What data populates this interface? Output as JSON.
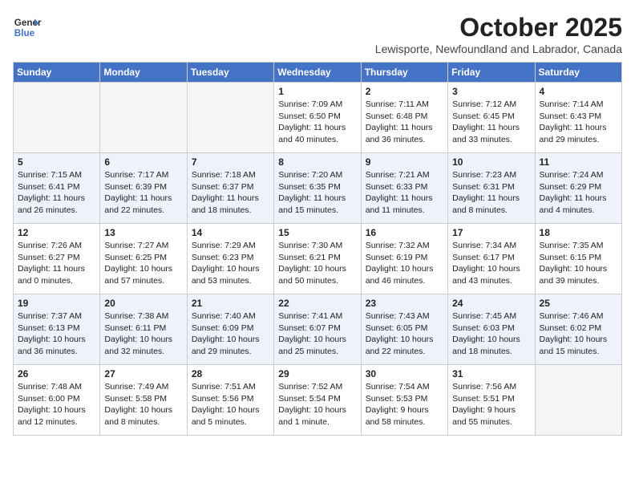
{
  "header": {
    "logo_line1": "General",
    "logo_line2": "Blue",
    "month": "October 2025",
    "subtitle": "Lewisporte, Newfoundland and Labrador, Canada"
  },
  "weekdays": [
    "Sunday",
    "Monday",
    "Tuesday",
    "Wednesday",
    "Thursday",
    "Friday",
    "Saturday"
  ],
  "weeks": [
    [
      {
        "day": "",
        "content": ""
      },
      {
        "day": "",
        "content": ""
      },
      {
        "day": "",
        "content": ""
      },
      {
        "day": "1",
        "content": "Sunrise: 7:09 AM\nSunset: 6:50 PM\nDaylight: 11 hours\nand 40 minutes."
      },
      {
        "day": "2",
        "content": "Sunrise: 7:11 AM\nSunset: 6:48 PM\nDaylight: 11 hours\nand 36 minutes."
      },
      {
        "day": "3",
        "content": "Sunrise: 7:12 AM\nSunset: 6:45 PM\nDaylight: 11 hours\nand 33 minutes."
      },
      {
        "day": "4",
        "content": "Sunrise: 7:14 AM\nSunset: 6:43 PM\nDaylight: 11 hours\nand 29 minutes."
      }
    ],
    [
      {
        "day": "5",
        "content": "Sunrise: 7:15 AM\nSunset: 6:41 PM\nDaylight: 11 hours\nand 26 minutes."
      },
      {
        "day": "6",
        "content": "Sunrise: 7:17 AM\nSunset: 6:39 PM\nDaylight: 11 hours\nand 22 minutes."
      },
      {
        "day": "7",
        "content": "Sunrise: 7:18 AM\nSunset: 6:37 PM\nDaylight: 11 hours\nand 18 minutes."
      },
      {
        "day": "8",
        "content": "Sunrise: 7:20 AM\nSunset: 6:35 PM\nDaylight: 11 hours\nand 15 minutes."
      },
      {
        "day": "9",
        "content": "Sunrise: 7:21 AM\nSunset: 6:33 PM\nDaylight: 11 hours\nand 11 minutes."
      },
      {
        "day": "10",
        "content": "Sunrise: 7:23 AM\nSunset: 6:31 PM\nDaylight: 11 hours\nand 8 minutes."
      },
      {
        "day": "11",
        "content": "Sunrise: 7:24 AM\nSunset: 6:29 PM\nDaylight: 11 hours\nand 4 minutes."
      }
    ],
    [
      {
        "day": "12",
        "content": "Sunrise: 7:26 AM\nSunset: 6:27 PM\nDaylight: 11 hours\nand 0 minutes."
      },
      {
        "day": "13",
        "content": "Sunrise: 7:27 AM\nSunset: 6:25 PM\nDaylight: 10 hours\nand 57 minutes."
      },
      {
        "day": "14",
        "content": "Sunrise: 7:29 AM\nSunset: 6:23 PM\nDaylight: 10 hours\nand 53 minutes."
      },
      {
        "day": "15",
        "content": "Sunrise: 7:30 AM\nSunset: 6:21 PM\nDaylight: 10 hours\nand 50 minutes."
      },
      {
        "day": "16",
        "content": "Sunrise: 7:32 AM\nSunset: 6:19 PM\nDaylight: 10 hours\nand 46 minutes."
      },
      {
        "day": "17",
        "content": "Sunrise: 7:34 AM\nSunset: 6:17 PM\nDaylight: 10 hours\nand 43 minutes."
      },
      {
        "day": "18",
        "content": "Sunrise: 7:35 AM\nSunset: 6:15 PM\nDaylight: 10 hours\nand 39 minutes."
      }
    ],
    [
      {
        "day": "19",
        "content": "Sunrise: 7:37 AM\nSunset: 6:13 PM\nDaylight: 10 hours\nand 36 minutes."
      },
      {
        "day": "20",
        "content": "Sunrise: 7:38 AM\nSunset: 6:11 PM\nDaylight: 10 hours\nand 32 minutes."
      },
      {
        "day": "21",
        "content": "Sunrise: 7:40 AM\nSunset: 6:09 PM\nDaylight: 10 hours\nand 29 minutes."
      },
      {
        "day": "22",
        "content": "Sunrise: 7:41 AM\nSunset: 6:07 PM\nDaylight: 10 hours\nand 25 minutes."
      },
      {
        "day": "23",
        "content": "Sunrise: 7:43 AM\nSunset: 6:05 PM\nDaylight: 10 hours\nand 22 minutes."
      },
      {
        "day": "24",
        "content": "Sunrise: 7:45 AM\nSunset: 6:03 PM\nDaylight: 10 hours\nand 18 minutes."
      },
      {
        "day": "25",
        "content": "Sunrise: 7:46 AM\nSunset: 6:02 PM\nDaylight: 10 hours\nand 15 minutes."
      }
    ],
    [
      {
        "day": "26",
        "content": "Sunrise: 7:48 AM\nSunset: 6:00 PM\nDaylight: 10 hours\nand 12 minutes."
      },
      {
        "day": "27",
        "content": "Sunrise: 7:49 AM\nSunset: 5:58 PM\nDaylight: 10 hours\nand 8 minutes."
      },
      {
        "day": "28",
        "content": "Sunrise: 7:51 AM\nSunset: 5:56 PM\nDaylight: 10 hours\nand 5 minutes."
      },
      {
        "day": "29",
        "content": "Sunrise: 7:52 AM\nSunset: 5:54 PM\nDaylight: 10 hours\nand 1 minute."
      },
      {
        "day": "30",
        "content": "Sunrise: 7:54 AM\nSunset: 5:53 PM\nDaylight: 9 hours\nand 58 minutes."
      },
      {
        "day": "31",
        "content": "Sunrise: 7:56 AM\nSunset: 5:51 PM\nDaylight: 9 hours\nand 55 minutes."
      },
      {
        "day": "",
        "content": ""
      }
    ]
  ]
}
